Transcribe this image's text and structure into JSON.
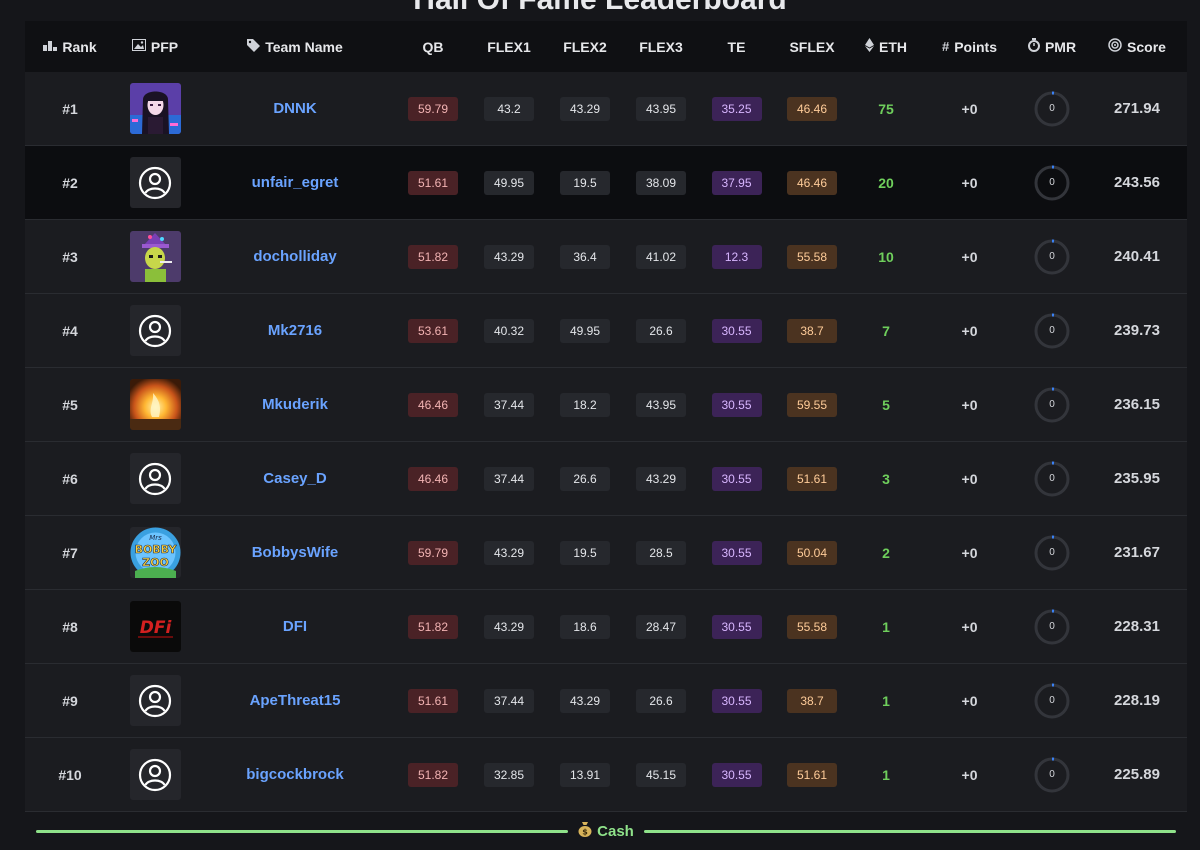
{
  "title": "Hall Of Fame Leaderboard",
  "headers": {
    "rank": "Rank",
    "pfp": "PFP",
    "team": "Team Name",
    "qb": "QB",
    "flex1": "FLEX1",
    "flex2": "FLEX2",
    "flex3": "FLEX3",
    "te": "TE",
    "sflex": "SFLEX",
    "eth": "ETH",
    "points": "Points",
    "pmr": "PMR",
    "score": "Score"
  },
  "header_icons": {
    "rank": "podium-icon",
    "pfp": "image-icon",
    "team": "tag-icon",
    "eth": "ethereum-icon",
    "points": "hash-icon",
    "pmr": "stopwatch-icon",
    "score": "target-icon"
  },
  "colors": {
    "team_link": "#6aa3ff",
    "eth_green": "#6fcf5c",
    "qb_pill": "#4a2226",
    "te_pill": "#3c2357",
    "sflex_pill": "#4b3320",
    "cash_green": "#8fe28a"
  },
  "rows": [
    {
      "rank": "#1",
      "avatar": "anime-girl-avatar",
      "team": "DNNK",
      "qb": "59.79",
      "flex1": "43.2",
      "flex2": "43.29",
      "flex3": "43.95",
      "te": "35.25",
      "sflex": "46.46",
      "eth": "75",
      "points": "+0",
      "pmr": "0",
      "score": "271.94"
    },
    {
      "rank": "#2",
      "avatar": "default-user-icon",
      "team": "unfair_egret",
      "qb": "51.61",
      "flex1": "49.95",
      "flex2": "19.5",
      "flex3": "38.09",
      "te": "37.95",
      "sflex": "46.46",
      "eth": "20",
      "points": "+0",
      "pmr": "0",
      "score": "243.56"
    },
    {
      "rank": "#3",
      "avatar": "cartoon-character-avatar",
      "team": "docholliday",
      "qb": "51.82",
      "flex1": "43.29",
      "flex2": "36.4",
      "flex3": "41.02",
      "te": "12.3",
      "sflex": "55.58",
      "eth": "10",
      "points": "+0",
      "pmr": "0",
      "score": "240.41"
    },
    {
      "rank": "#4",
      "avatar": "default-user-icon",
      "team": "Mk2716",
      "qb": "53.61",
      "flex1": "40.32",
      "flex2": "49.95",
      "flex3": "26.6",
      "te": "30.55",
      "sflex": "38.7",
      "eth": "7",
      "points": "+0",
      "pmr": "0",
      "score": "239.73"
    },
    {
      "rank": "#5",
      "avatar": "fire-avatar",
      "team": "Mkuderik",
      "qb": "46.46",
      "flex1": "37.44",
      "flex2": "18.2",
      "flex3": "43.95",
      "te": "30.55",
      "sflex": "59.55",
      "eth": "5",
      "points": "+0",
      "pmr": "0",
      "score": "236.15"
    },
    {
      "rank": "#6",
      "avatar": "default-user-icon",
      "team": "Casey_D",
      "qb": "46.46",
      "flex1": "37.44",
      "flex2": "26.6",
      "flex3": "43.29",
      "te": "30.55",
      "sflex": "51.61",
      "eth": "3",
      "points": "+0",
      "pmr": "0",
      "score": "235.95"
    },
    {
      "rank": "#7",
      "avatar": "bobby-zoo-logo-avatar",
      "team": "BobbysWife",
      "qb": "59.79",
      "flex1": "43.29",
      "flex2": "19.5",
      "flex3": "28.5",
      "te": "30.55",
      "sflex": "50.04",
      "eth": "2",
      "points": "+0",
      "pmr": "0",
      "score": "231.67"
    },
    {
      "rank": "#8",
      "avatar": "dfi-logo-avatar",
      "team": "DFI",
      "qb": "51.82",
      "flex1": "43.29",
      "flex2": "18.6",
      "flex3": "28.47",
      "te": "30.55",
      "sflex": "55.58",
      "eth": "1",
      "points": "+0",
      "pmr": "0",
      "score": "228.31"
    },
    {
      "rank": "#9",
      "avatar": "default-user-icon",
      "team": "ApeThreat15",
      "qb": "51.61",
      "flex1": "37.44",
      "flex2": "43.29",
      "flex3": "26.6",
      "te": "30.55",
      "sflex": "38.7",
      "eth": "1",
      "points": "+0",
      "pmr": "0",
      "score": "228.19"
    },
    {
      "rank": "#10",
      "avatar": "default-user-icon",
      "team": "bigcockbrock",
      "qb": "51.82",
      "flex1": "32.85",
      "flex2": "13.91",
      "flex3": "45.15",
      "te": "30.55",
      "sflex": "51.61",
      "eth": "1",
      "points": "+0",
      "pmr": "0",
      "score": "225.89"
    }
  ],
  "cash_divider": {
    "label": "Cash",
    "icon": "money-bag-icon"
  }
}
